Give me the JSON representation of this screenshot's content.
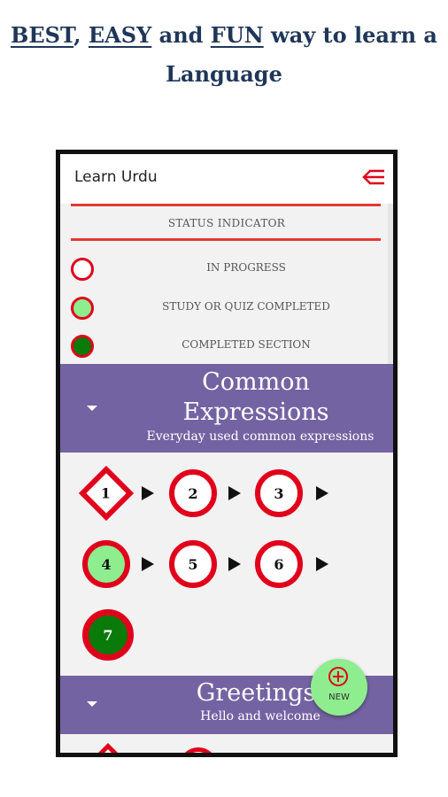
{
  "headline": {
    "w1": "BEST",
    "sep1": ", ",
    "w2": "EASY",
    "sep2": " and ",
    "w3": "FUN",
    "rest": " way to learn a",
    "line2": "Language"
  },
  "app": {
    "title": "Learn Urdu",
    "menu_icon": "menu-arrow-icon"
  },
  "status_indicator": {
    "title": "STATUS INDICATOR",
    "items": [
      {
        "label": "IN PROGRESS",
        "state": "in-progress",
        "fill": "#ffffff"
      },
      {
        "label": "STUDY OR QUIZ COMPLETED",
        "state": "study-completed",
        "fill": "#8eed8e"
      },
      {
        "label": "COMPLETED SECTION",
        "state": "section-completed",
        "fill": "#0a7a0a"
      }
    ]
  },
  "sections": [
    {
      "title_line1": "Common",
      "title_line2": "Expressions",
      "subtitle": "Everyday used common expressions",
      "nodes": [
        "1",
        "2",
        "3",
        "4",
        "5",
        "6",
        "7"
      ]
    },
    {
      "title": "Greetings",
      "subtitle": "Hello and welcome"
    }
  ],
  "fab": {
    "label": "NEW",
    "icon": "add-circle-icon"
  },
  "colors": {
    "accent_red": "#e0001b",
    "section_purple": "#7463a2",
    "headline_navy": "#1f3658",
    "light_green": "#8eed8e",
    "dark_green": "#0a7a0a"
  }
}
